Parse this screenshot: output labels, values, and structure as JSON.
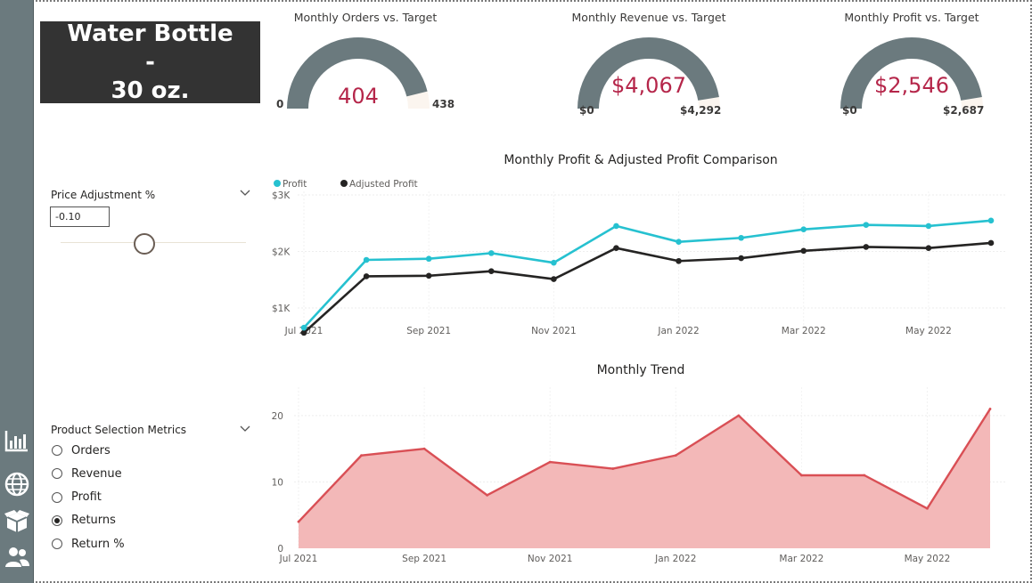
{
  "title": "Water Bottle -\n30 oz.",
  "gauges": [
    {
      "id": "orders",
      "title": "Monthly Orders vs. Target",
      "value_label": "404",
      "min_label": "0",
      "max_label": "438",
      "fraction": 0.922
    },
    {
      "id": "revenue",
      "title": "Monthly Revenue vs. Target",
      "value_label": "$4,067",
      "min_label": "$0",
      "max_label": "$4,292",
      "fraction": 0.948
    },
    {
      "id": "profit",
      "title": "Monthly Profit vs. Target",
      "value_label": "$2,546",
      "min_label": "$0",
      "max_label": "$2,687",
      "fraction": 0.948
    }
  ],
  "price_slicer": {
    "label": "Price Adjustment %",
    "value": "-0.10"
  },
  "metrics_slicer": {
    "label": "Product Selection Metrics",
    "options": [
      "Orders",
      "Revenue",
      "Profit",
      "Returns",
      "Return %"
    ],
    "selected": "Returns"
  },
  "colors": {
    "profit": "#26c1d0",
    "adjusted": "#252423",
    "trend_line": "#d94f55",
    "trend_fill": "#f3b8b8",
    "gauge": "#6b7a7e",
    "gauge_bg": "#fbf5ef",
    "value": "#b5264a"
  },
  "chart_data": [
    {
      "type": "line",
      "title": "Monthly Profit & Adjusted Profit Comparison",
      "x": [
        "Jul 2021",
        "Aug 2021",
        "Sep 2021",
        "Oct 2021",
        "Nov 2021",
        "Dec 2021",
        "Jan 2022",
        "Feb 2022",
        "Mar 2022",
        "Apr 2022",
        "May 2022",
        "Jun 2022"
      ],
      "x_tick_labels": [
        "Jul 2021",
        "Sep 2021",
        "Nov 2021",
        "Jan 2022",
        "Mar 2022",
        "May 2022"
      ],
      "y_tick_labels": [
        "$1K",
        "$2K",
        "$3K"
      ],
      "ylim": [
        700,
        3000
      ],
      "legend": "top-left",
      "series": [
        {
          "name": "Profit",
          "values": [
            650,
            1850,
            1870,
            1970,
            1800,
            2450,
            2170,
            2240,
            2390,
            2470,
            2450,
            2546
          ]
        },
        {
          "name": "Adjusted Profit",
          "values": [
            560,
            1560,
            1570,
            1650,
            1510,
            2060,
            1830,
            1880,
            2010,
            2080,
            2060,
            2150
          ]
        }
      ]
    },
    {
      "type": "area",
      "title": "Monthly Trend",
      "x": [
        "Jul 2021",
        "Aug 2021",
        "Sep 2021",
        "Oct 2021",
        "Nov 2021",
        "Dec 2021",
        "Jan 2022",
        "Feb 2022",
        "Mar 2022",
        "Apr 2022",
        "May 2022",
        "Jun 2022"
      ],
      "x_tick_labels": [
        "Jul 2021",
        "Sep 2021",
        "Nov 2021",
        "Jan 2022",
        "Mar 2022",
        "May 2022"
      ],
      "y_tick_labels": [
        "0",
        "10",
        "20"
      ],
      "ylim": [
        0,
        22
      ],
      "values": [
        4,
        14,
        15,
        8,
        13,
        12,
        14,
        20,
        11,
        11,
        6,
        21
      ]
    }
  ]
}
